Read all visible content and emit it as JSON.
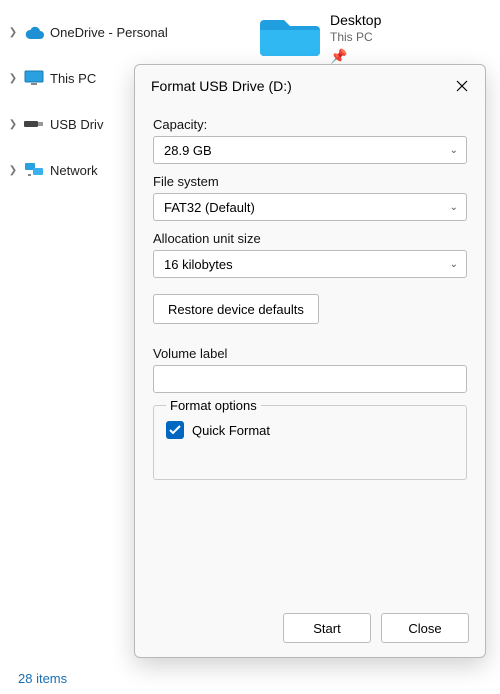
{
  "tree": {
    "items": [
      {
        "label": "OneDrive - Personal"
      },
      {
        "label": "This PC"
      },
      {
        "label": "USB Driv"
      },
      {
        "label": "Network"
      }
    ]
  },
  "desktop": {
    "title": "Desktop",
    "subtitle": "This PC"
  },
  "dialog": {
    "title": "Format USB Drive (D:)",
    "capacity_label": "Capacity:",
    "capacity_value": "28.9 GB",
    "filesystem_label": "File system",
    "filesystem_value": "FAT32 (Default)",
    "allocation_label": "Allocation unit size",
    "allocation_value": "16 kilobytes",
    "restore_label": "Restore device defaults",
    "volume_label": "Volume label",
    "volume_value": "",
    "format_options_legend": "Format options",
    "quick_format_label": "Quick Format",
    "start_label": "Start",
    "close_label": "Close"
  },
  "status": {
    "items_text": "28 items"
  }
}
